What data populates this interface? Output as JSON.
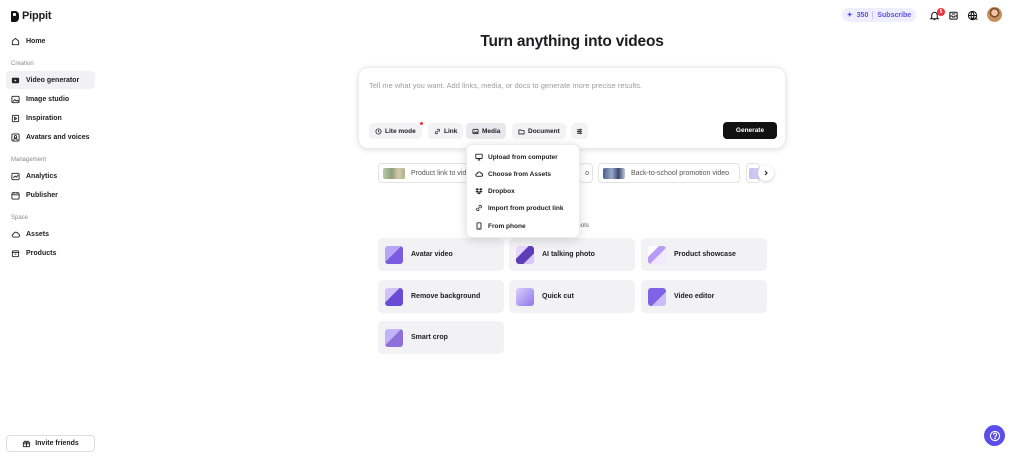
{
  "brand": {
    "name": "Pippit"
  },
  "sidebar": {
    "items": [
      {
        "label": "Home",
        "icon": "home-icon"
      },
      {
        "label": "Video generator",
        "icon": "video-generator-icon",
        "active": true
      },
      {
        "label": "Image studio",
        "icon": "image-icon"
      },
      {
        "label": "Inspiration",
        "icon": "inspiration-icon"
      },
      {
        "label": "Avatars and voices",
        "icon": "avatar-icon"
      },
      {
        "label": "Analytics",
        "icon": "analytics-icon"
      },
      {
        "label": "Publisher",
        "icon": "calendar-icon"
      },
      {
        "label": "Assets",
        "icon": "cloud-icon"
      },
      {
        "label": "Products",
        "icon": "products-icon"
      }
    ],
    "sections": {
      "creation": "Creation",
      "management": "Management",
      "space": "Space"
    },
    "invite_label": "Invite friends"
  },
  "topbar": {
    "credits": "350",
    "subscribe_label": "Subscribe",
    "notification_count": "5",
    "language": "EN"
  },
  "main": {
    "title": "Turn anything into videos",
    "prompt_placeholder": "Tell me what you want. Add links, media, or docs to generate more precise results.",
    "chips": {
      "lite_mode": "Lite mode",
      "link": "Link",
      "media": "Media",
      "document": "Document"
    },
    "generate_label": "Generate",
    "suggestions": [
      "Product link to video",
      "Back-to-school promotion video"
    ],
    "tools_label": "ools",
    "tools": [
      "Avatar video",
      "AI talking photo",
      "Product showcase",
      "Remove background",
      "Quick cut",
      "Video editor",
      "Smart crop"
    ]
  },
  "media_menu": {
    "items": [
      {
        "label": "Upload from computer",
        "icon": "monitor-icon"
      },
      {
        "label": "Choose from Assets",
        "icon": "cloud-icon"
      },
      {
        "label": "Dropbox",
        "icon": "dropbox-icon"
      },
      {
        "label": "Import from product link",
        "icon": "link-icon"
      },
      {
        "label": "From phone",
        "icon": "phone-icon"
      }
    ]
  },
  "colors": {
    "accent": "#5b4ee8",
    "badge": "#f0323c",
    "primary_button": "#111111"
  }
}
